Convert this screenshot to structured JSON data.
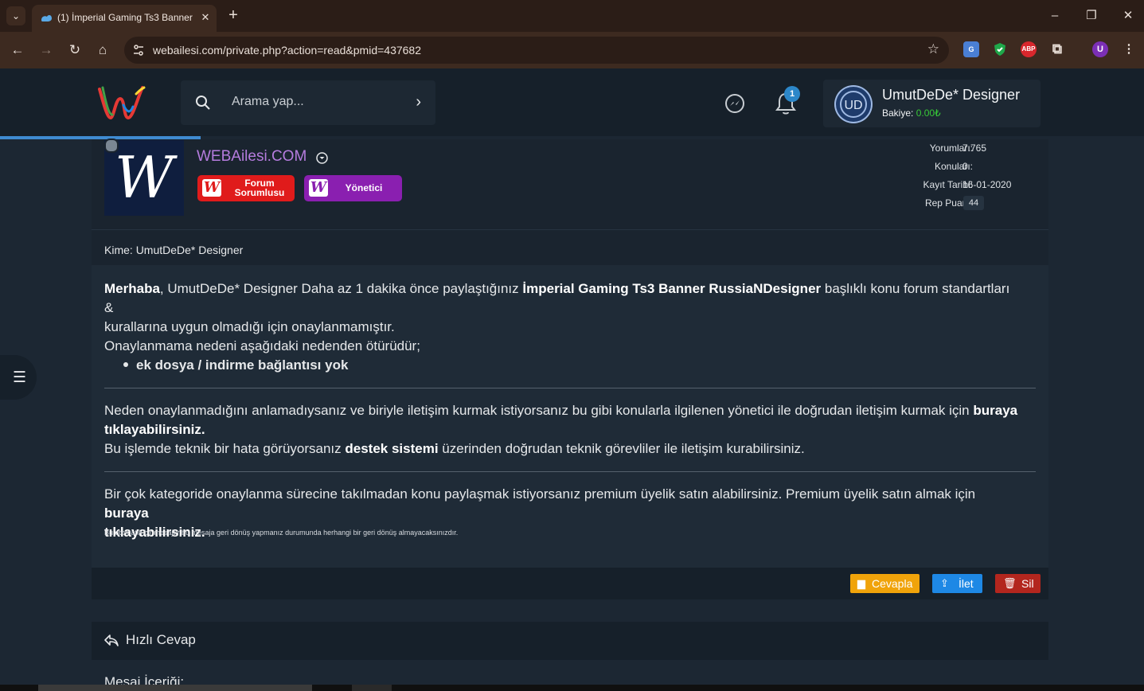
{
  "browser": {
    "tab_title": "(1) İmperial Gaming Ts3 Banner RussiaNDesigner",
    "url": "webailesi.com/private.php?action=read&pmid=437682",
    "extensions": [
      "translate-icon",
      "shield-icon",
      "adblock-icon",
      "puzzle-icon"
    ],
    "profile_initial": "U"
  },
  "header": {
    "search_placeholder": "Arama yap...",
    "notification_count": "1",
    "user_name": "UmutDeDe* Designer",
    "balance_label": "Bakiye:",
    "balance_value": "0.00₺"
  },
  "sender": {
    "name": "WEBAilesi.COM",
    "avatar_letter": "W",
    "badges": [
      {
        "line1": "Forum",
        "line2": "Sorumlusu",
        "color": "#e01b1b"
      },
      {
        "line1": "Yönetici",
        "line2": "",
        "color": "#8a1fb0"
      }
    ],
    "stats": [
      {
        "label": "Yorumları:",
        "value": "7.765"
      },
      {
        "label": "Konuları:",
        "value": "0"
      },
      {
        "label": "Kayıt Tarihi:",
        "value": "16-01-2020"
      },
      {
        "label": "Rep Puanı:",
        "value": "44"
      }
    ]
  },
  "message": {
    "to_label": "Kime:",
    "to_name": "UmutDeDe* Designer",
    "greeting": "Merhaba",
    "p1_a": ", UmutDeDe* Designer Daha az 1 dakika önce paylaştığınız ",
    "p1_topic": "İmperial Gaming Ts3 Banner RussiaNDesigner",
    "p1_b": " başlıklı konu forum standartları &",
    "p1_c": "kurallarına uygun olmadığı için onaylanmamıştır.",
    "p2": "Onaylanmama nedeni aşağıdaki nedenden ötürüdür;",
    "reason": "ek dosya / indirme bağlantısı yok",
    "p3_a": "Neden onaylanmadığını anlamadıysanız ve biriyle iletişim kurmak istiyorsanız bu gibi konularla ilgilenen yönetici ile doğrudan iletişim kurmak için ",
    "p3_link1": "buraya",
    "p3_link2": "tıklayabilirsiniz.",
    "p4_a": "Bu işlemde teknik bir hata görüyorsanız ",
    "p4_link": "destek sistemi",
    "p4_b": " üzerinden doğrudan teknik görevliler ile iletişim kurabilirsiniz.",
    "p5_a": "Bir çok kategoride onaylanma sürecine takılmadan konu paylaşmak istiyorsanız premium üyelik satın alabilirsiniz. Premium üyelik satın almak için ",
    "p5_link1": "buraya",
    "p5_link2": "tıklayabilirsiniz.",
    "note": "Bu otomatik bir mesajtır bu mesaja geri dönüş yapmanız durumunda herhangi bir geri dönüş almayacaksınızdır."
  },
  "actions": {
    "reply": "Cevapla",
    "forward": "İlet",
    "delete": "Sil",
    "colors": {
      "reply": "#f0a30a",
      "forward": "#1e88e5",
      "delete": "#b3261e"
    }
  },
  "quick_reply": {
    "title": "Hızlı Cevap",
    "content_label": "Mesaj İçeriği:"
  }
}
